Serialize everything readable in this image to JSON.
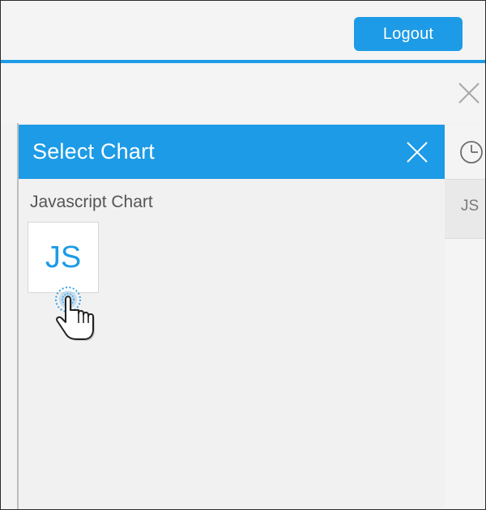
{
  "header": {
    "logout_label": "Logout"
  },
  "panel": {
    "title": "Select Chart",
    "section_label": "Javascript Chart",
    "tile_label": "JS"
  },
  "rail": {
    "tab_label": "JS"
  },
  "icons": {
    "subbar_close": "close-icon",
    "panel_close": "close-icon",
    "rail_clock": "clock-icon",
    "cursor": "hand-pointer-icon"
  },
  "colors": {
    "accent": "#1d9be6",
    "panel_bg": "#f1f1f1",
    "header_bg": "#f4f4f4"
  }
}
